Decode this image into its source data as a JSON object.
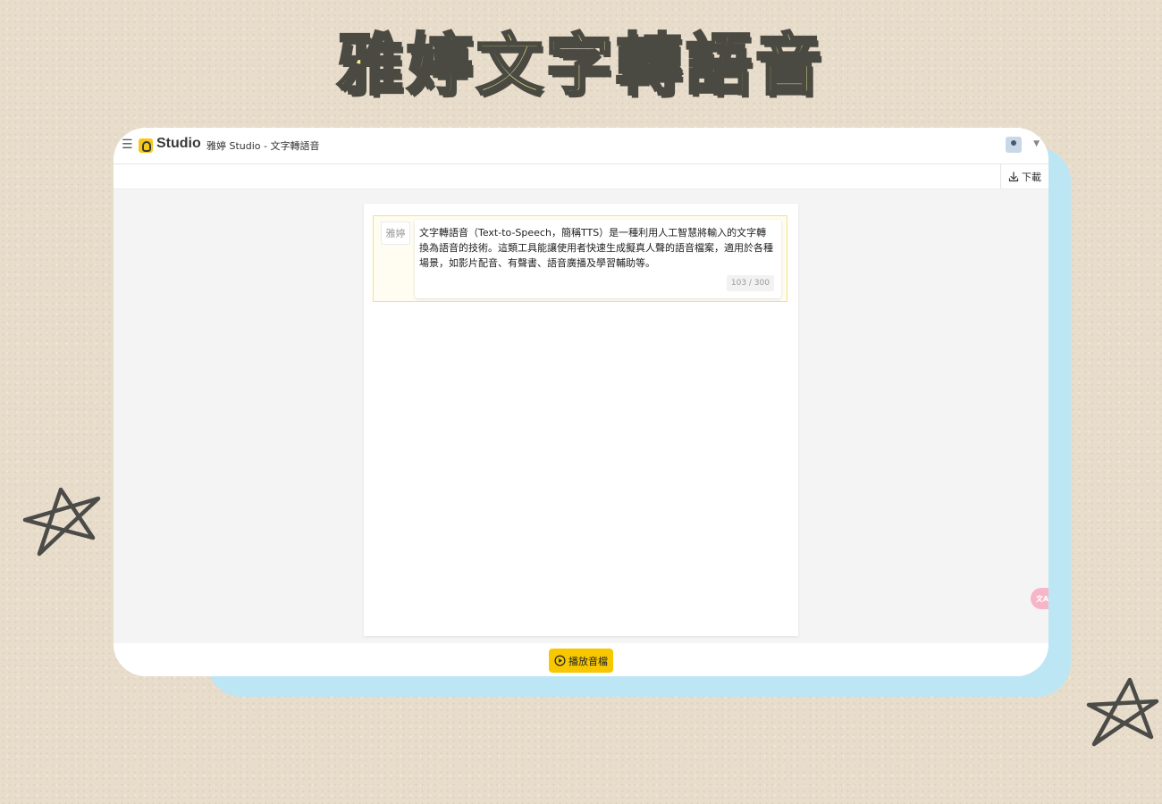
{
  "poster": {
    "title": "雅婷文字轉語音"
  },
  "header": {
    "menu_icon": "hamburger-icon",
    "brand": "Studio",
    "app_title": "雅婷 Studio - 文字轉語音"
  },
  "toolbar": {
    "download_label": "下載"
  },
  "editor": {
    "speaker": "雅婷",
    "text": "文字轉語音（Text-to-Speech，簡稱TTS）是一種利用人工智慧將輸入的文字轉換為語音的技術。這類工具能讓使用者快速生成擬真人聲的語音檔案，適用於各種場景，如影片配音、有聲書、語音廣播及學習輔助等。",
    "char_count": "103 / 300"
  },
  "footer": {
    "play_label": "播放音檔"
  },
  "colors": {
    "accent": "#f7c800",
    "block_border": "#f4e27a",
    "backdrop": "#bde6f5",
    "paper": "#e8dccb"
  }
}
